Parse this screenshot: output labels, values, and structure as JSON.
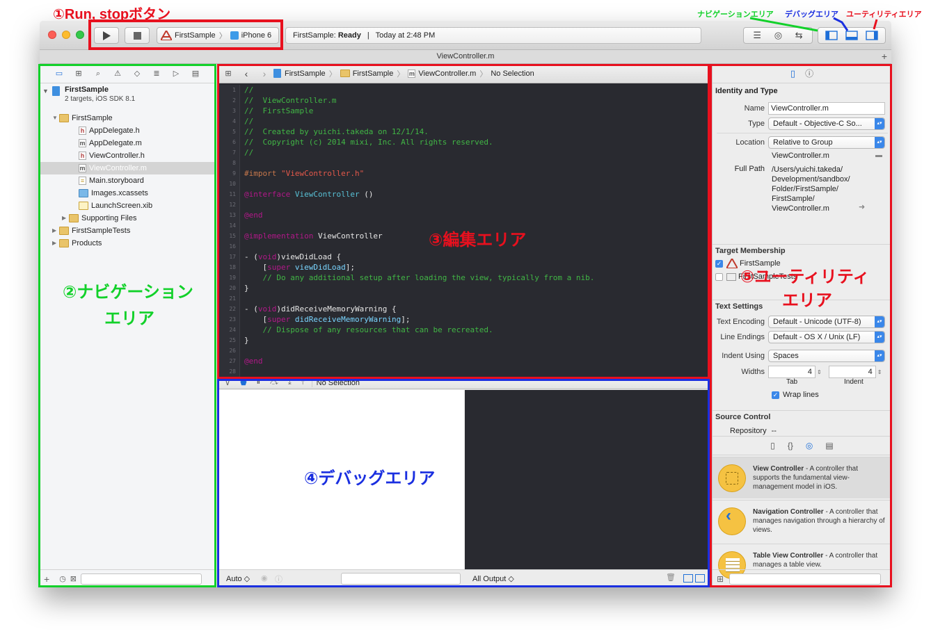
{
  "annotations": {
    "run_stop": "①Run, stopボタン",
    "nav_area_line1": "②ナビゲーション",
    "nav_area_line2": "エリア",
    "edit_area": "③編集エリア",
    "debug_area": "④デバッグエリア",
    "util_area_line1": "⑤ユーティリティ",
    "util_area_line2": "エリア",
    "top_nav": "ナビゲーションエリア",
    "top_debug": "デバッグエリア",
    "top_util": "ユーティリティエリア"
  },
  "colors": {
    "green": "#12d12a",
    "red": "#e8101e",
    "blue": "#1a2fe0"
  },
  "toolbar": {
    "scheme": "FirstSample",
    "device": "iPhone 6",
    "status_app": "FirstSample:",
    "status_state": "Ready",
    "status_sep": "|",
    "status_time": "Today at 2:48 PM"
  },
  "tab": {
    "title": "ViewController.m",
    "add": "+"
  },
  "navigator": {
    "project": "FirstSample",
    "project_sub": "2 targets, iOS SDK 8.1",
    "items": [
      {
        "label": "FirstSample",
        "type": "folder"
      },
      {
        "label": "AppDelegate.h",
        "type": "h"
      },
      {
        "label": "AppDelegate.m",
        "type": "m"
      },
      {
        "label": "ViewController.h",
        "type": "h"
      },
      {
        "label": "ViewController.m",
        "type": "m"
      },
      {
        "label": "Main.storyboard",
        "type": "storyboard"
      },
      {
        "label": "Images.xcassets",
        "type": "assets"
      },
      {
        "label": "LaunchScreen.xib",
        "type": "xib"
      },
      {
        "label": "Supporting Files",
        "type": "folder"
      },
      {
        "label": "FirstSampleTests",
        "type": "folder"
      },
      {
        "label": "Products",
        "type": "folder"
      }
    ],
    "bottom_add": "+"
  },
  "editor": {
    "crumbs": [
      "FirstSample",
      "FirstSample",
      "ViewController.m",
      "No Selection"
    ],
    "line_numbers": [
      "1",
      "2",
      "3",
      "4",
      "5",
      "6",
      "7",
      "8",
      "9",
      "10",
      "11",
      "12",
      "13",
      "14",
      "15",
      "16",
      "17",
      "18",
      "19",
      "20",
      "21",
      "22",
      "23",
      "24",
      "25",
      "26",
      "27",
      "28"
    ],
    "lines": {
      "l1": "//",
      "l2": "//  ViewController.m",
      "l3": "//  FirstSample",
      "l4": "//",
      "l5": "//  Created by yuichi.takeda on 12/1/14.",
      "l6": "//  Copyright (c) 2014 mixi, Inc. All rights reserved.",
      "l7": "//",
      "l9a": "#import ",
      "l9b": "\"ViewController.h\"",
      "l11a": "@interface",
      "l11b": " ViewController",
      "l11c": " ()",
      "l13": "@end",
      "l15a": "@implementation",
      "l15b": " ViewController",
      "l17a": "- (",
      "l17b": "void",
      "l17c": ")viewDidLoad {",
      "l18a": "    [",
      "l18b": "super",
      "l18c": " viewDidLoad",
      "l18d": "];",
      "l19": "    // Do any additional setup after loading the view, typically from a nib.",
      "l20": "}",
      "l22a": "- (",
      "l22b": "void",
      "l22c": ")didReceiveMemoryWarning {",
      "l23a": "    [",
      "l23b": "super",
      "l23c": " didReceiveMemoryWarning",
      "l23d": "];",
      "l24": "    // Dispose of any resources that can be recreated.",
      "l25": "}",
      "l27": "@end"
    }
  },
  "debug": {
    "selection": "No Selection",
    "auto": "Auto ◇",
    "output": "All Output ◇"
  },
  "utilities": {
    "identity_header": "Identity and Type",
    "name_label": "Name",
    "name_value": "ViewController.m",
    "type_label": "Type",
    "type_value": "Default - Objective-C So...",
    "location_label": "Location",
    "location_value": "Relative to Group",
    "location_file": "ViewController.m",
    "fullpath_label": "Full Path",
    "fullpath_lines": [
      "/Users/yuichi.takeda/",
      "Development/sandbox/",
      "Folder/FirstSample/",
      "FirstSample/",
      "ViewController.m"
    ],
    "target_header": "Target Membership",
    "target1": "FirstSample",
    "target2": "FirstSampleTests",
    "text_header": "Text Settings",
    "encoding_label": "Text Encoding",
    "encoding_value": "Default - Unicode (UTF-8)",
    "endings_label": "Line Endings",
    "endings_value": "Default - OS X / Unix (LF)",
    "indent_label": "Indent Using",
    "indent_value": "Spaces",
    "widths_label": "Widths",
    "tab_width": "4",
    "indent_width": "4",
    "tab_caption": "Tab",
    "indent_caption": "Indent",
    "wrap_label": "Wrap lines",
    "source_header": "Source Control",
    "repo_label": "Repository",
    "repo_value": "--",
    "library": [
      {
        "title": "View Controller",
        "desc": " - A controller that supports the fundamental view-management model in iOS."
      },
      {
        "title": "Navigation Controller",
        "desc": " - A controller that manages navigation through a hierarchy of views."
      },
      {
        "title": "Table View Controller",
        "desc": " - A controller that manages a table view."
      }
    ]
  }
}
